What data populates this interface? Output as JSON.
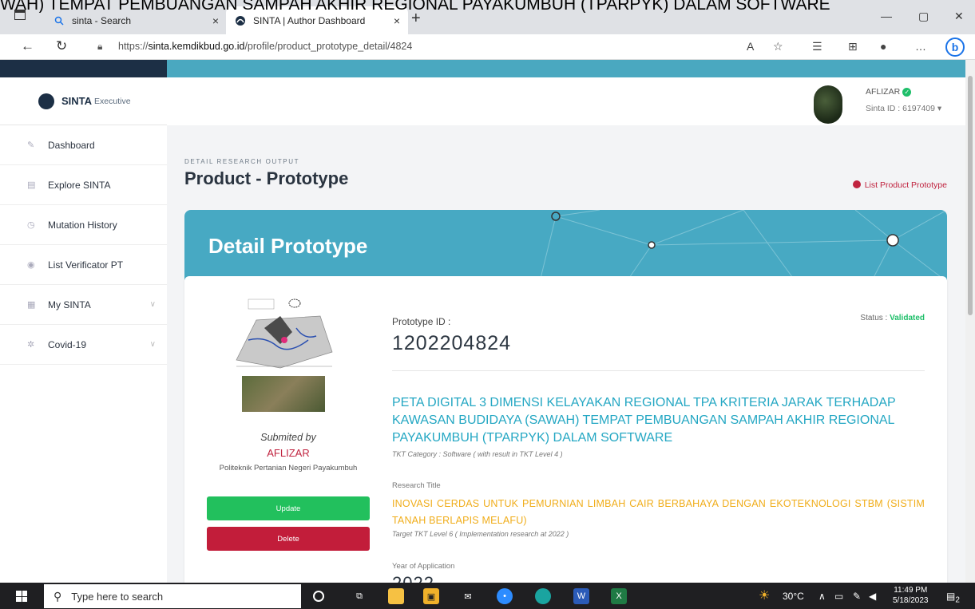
{
  "overlay_text": "WAH) TEMPAT PEMBUANGAN SAMPAH AKHIR REGIONAL PAYAKUMBUH (TPARPYK) DALAM SOFTWARE",
  "browser": {
    "tabs": [
      {
        "label": "sinta - Search",
        "icon": "search-icon",
        "close": "×"
      },
      {
        "label": "SINTA | Author Dashboard",
        "icon": "sinta-icon",
        "close": "×"
      }
    ],
    "new_tab": "+",
    "url_prefix": "https://",
    "url_host": "sinta.kemdikbud.go.id",
    "url_path": "/profile/product_prototype_detail/4824",
    "window_controls": [
      "—",
      "▢",
      "✕"
    ]
  },
  "sidebar": {
    "brand": "SINTA",
    "brand_sub": "Executive",
    "items": [
      {
        "label": "Dashboard",
        "icon": "pencil-icon",
        "chevron": ""
      },
      {
        "label": "Explore SINTA",
        "icon": "document-icon",
        "chevron": ""
      },
      {
        "label": "Mutation History",
        "icon": "history-icon",
        "chevron": ""
      },
      {
        "label": "List Verificator PT",
        "icon": "user-icon",
        "chevron": ""
      },
      {
        "label": "My SINTA",
        "icon": "grid-icon",
        "chevron": "∨"
      },
      {
        "label": "Covid-19",
        "icon": "virus-icon",
        "chevron": "∨"
      }
    ]
  },
  "header": {
    "user_name": "AFLIZAR",
    "sinta_id": "Sinta ID : 6197409"
  },
  "page": {
    "kicker": "DETAIL RESEARCH OUTPUT",
    "title": "Product - Prototype",
    "list_link": "List Product Prototype",
    "hero_title": "Detail Prototype"
  },
  "detail": {
    "submitted_by_label": "Submited by",
    "submitter": "AFLIZAR",
    "institution": "Politeknik Pertanian Negeri Payakumbuh",
    "update_label": "Update",
    "delete_label": "Delete",
    "prototype_id_label": "Prototype ID :",
    "prototype_id": "1202204824",
    "status_label": "Status :",
    "status_value": "Validated",
    "prototype_title": "PETA DIGITAL 3 DIMENSI KELAYAKAN REGIONAL TPA KRITERIA JARAK TERHADAP KAWASAN BUDIDAYA (SAWAH) TEMPAT PEMBUANGAN SAMPAH AKHIR REGIONAL PAYAKUMBUH (TPARPYK) DALAM SOFTWARE",
    "tkt_category": "TKT Category : Software ( with result in TKT Level  4 )",
    "research_title_label": "Research Title",
    "research_title": "INOVASI CERDAS UNTUK PEMURNIAN LIMBAH CAIR BERBAHAYA DENGAN EKOTEKNOLOGI STBM (SISTIM TANAH BERLAPIS MELAFU)",
    "target_tkt": "Target TKT Level 6 ( Implementation research at  2022 )",
    "year_label": "Year of Application",
    "year_value": "2022"
  },
  "taskbar": {
    "search_placeholder": "Type here to search",
    "temperature": "30°C",
    "time": "11:49 PM",
    "date": "5/18/2023",
    "notifications": "2"
  },
  "colors": {
    "accent": "#47a9c3",
    "sidebar_dark": "#1c2f45",
    "validated": "#1fbf6a",
    "danger": "#c21d3a",
    "research_title": "#f0ad1a"
  }
}
